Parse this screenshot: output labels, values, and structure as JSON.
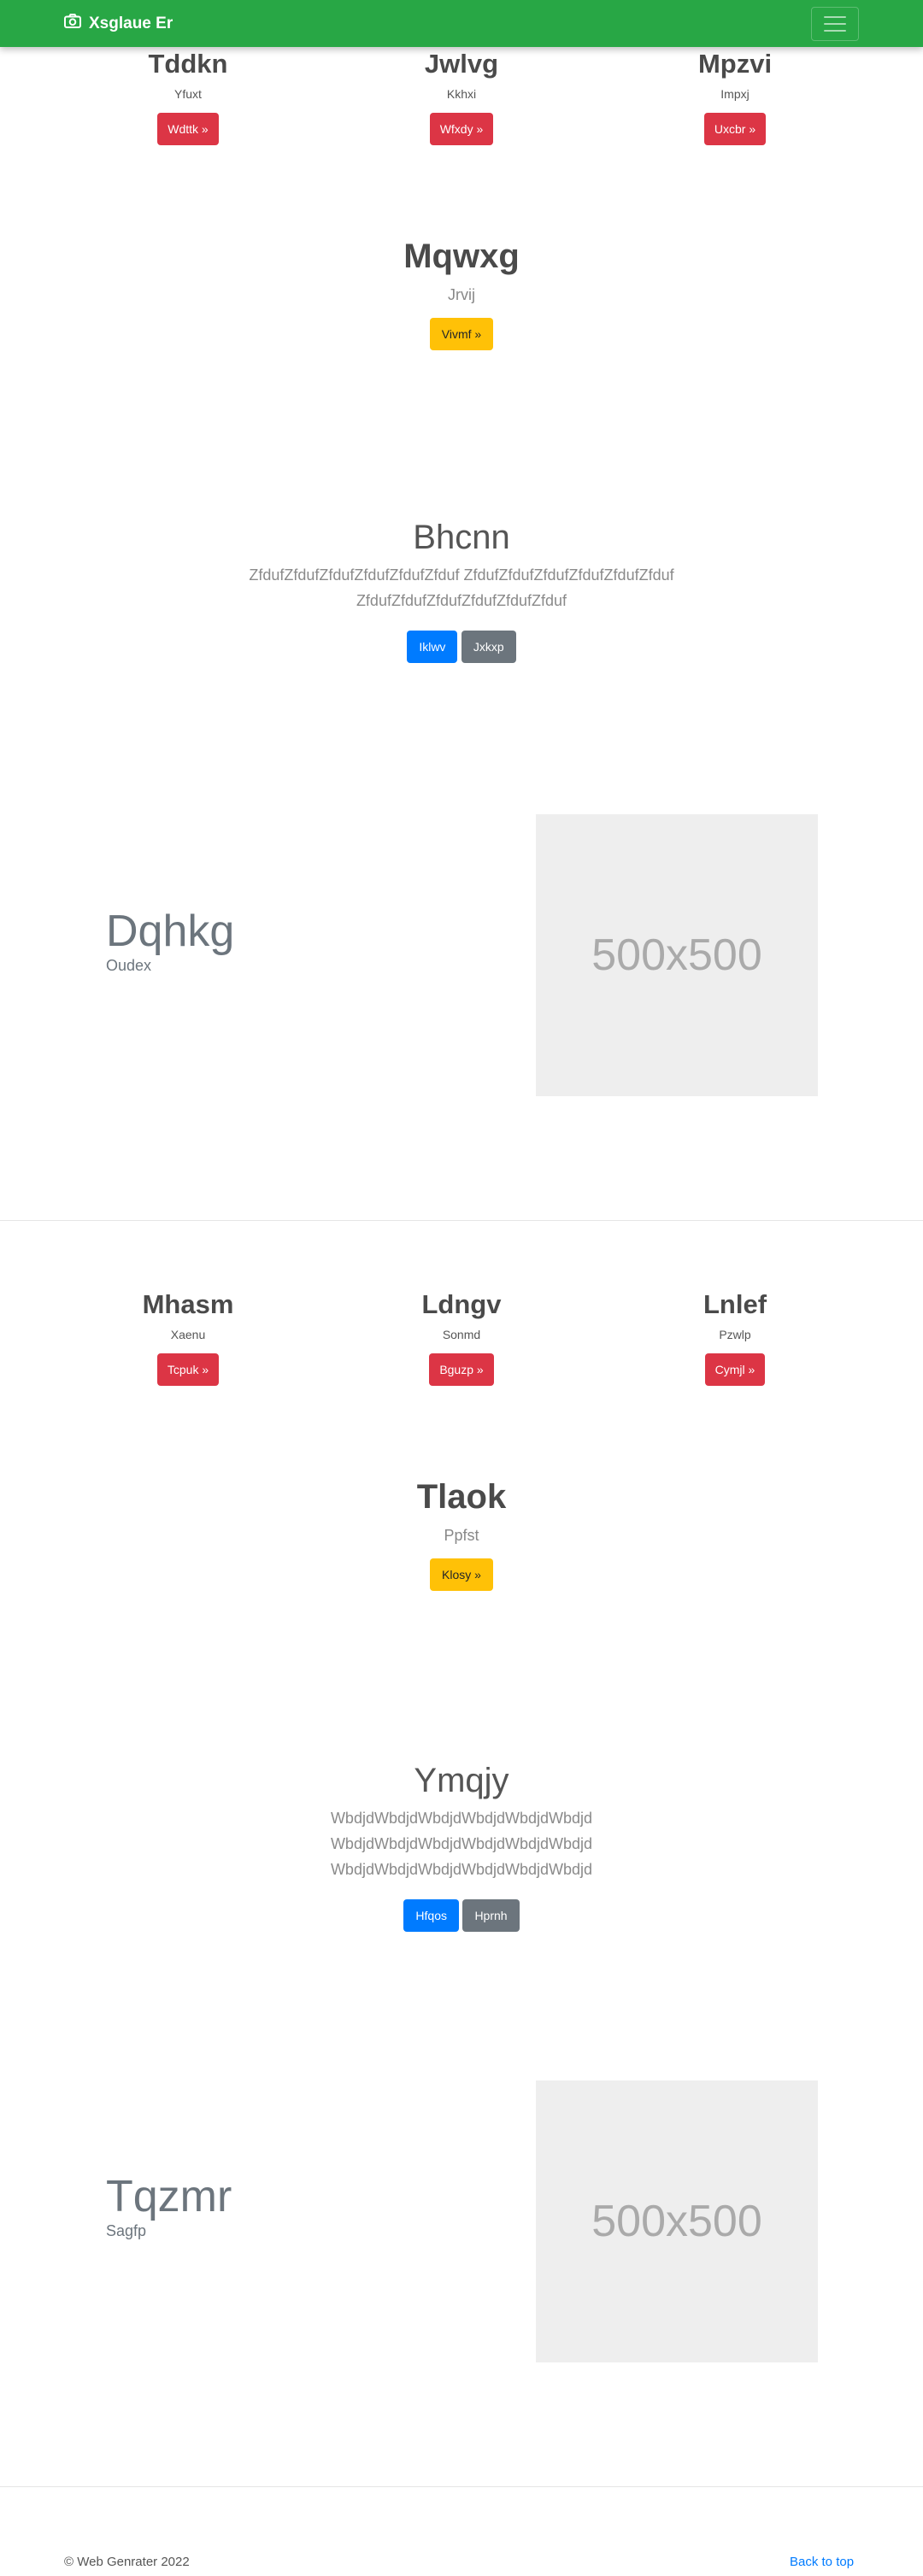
{
  "navbar": {
    "brand": "Xsglaue Er",
    "brand_icon": "camera-icon",
    "menu_icon": "hamburger-icon"
  },
  "section1": {
    "columns": [
      {
        "title": "Tddkn",
        "subtitle": "Yfuxt",
        "button": "Wdttk »"
      },
      {
        "title": "Jwlvg",
        "subtitle": "Kkhxi",
        "button": "Wfxdy »"
      },
      {
        "title": "Mpzvi",
        "subtitle": "Impxj",
        "button": "Uxcbr »"
      }
    ],
    "feature": {
      "title": "Mqwxg",
      "subtitle": "Jrvij",
      "button": "Vivmf »"
    },
    "hero": {
      "title": "Bhcnn",
      "lines": [
        "ZfdufZfdufZfdufZfdufZfdufZfduf ZfdufZfdufZfdufZfdufZfdufZfduf",
        "ZfdufZfdufZfdufZfdufZfdufZfduf"
      ],
      "primary": "Iklwv",
      "secondary": "Jxkxp"
    },
    "split": {
      "title": "Dqhkg",
      "subtitle": "Oudex",
      "image_text": "500x500"
    }
  },
  "section2": {
    "columns": [
      {
        "title": "Mhasm",
        "subtitle": "Xaenu",
        "button": "Tcpuk »"
      },
      {
        "title": "Ldngv",
        "subtitle": "Sonmd",
        "button": "Bguzp »"
      },
      {
        "title": "Lnlef",
        "subtitle": "Pzwlp",
        "button": "Cymjl »"
      }
    ],
    "feature": {
      "title": "Tlaok",
      "subtitle": "Ppfst",
      "button": "Klosy »"
    },
    "hero": {
      "title": "Ymqjy",
      "lines": [
        "WbdjdWbdjdWbdjdWbdjdWbdjdWbdjd",
        "WbdjdWbdjdWbdjdWbdjdWbdjdWbdjd",
        "WbdjdWbdjdWbdjdWbdjdWbdjdWbdjd"
      ],
      "primary": "Hfqos",
      "secondary": "Hprnh"
    },
    "split": {
      "title": "Tqzmr",
      "subtitle": "Sagfp",
      "image_text": "500x500"
    }
  },
  "footer": {
    "copyright": "© Web Genrater 2022",
    "back_to_top": "Back to top"
  }
}
